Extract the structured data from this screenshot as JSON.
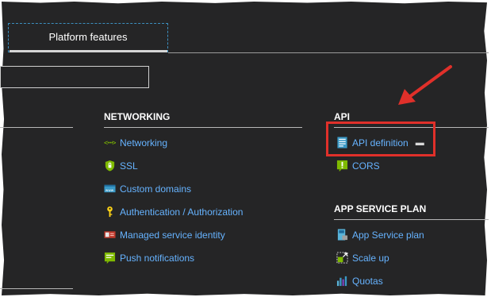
{
  "tabs": [
    {
      "label": "Platform features"
    }
  ],
  "search": {
    "value": ""
  },
  "networking": {
    "title": "NETWORKING",
    "items": [
      {
        "label": "Networking",
        "icon": "networking-icon"
      },
      {
        "label": "SSL",
        "icon": "ssl-shield-icon"
      },
      {
        "label": "Custom domains",
        "icon": "custom-domains-icon"
      },
      {
        "label": "Authentication / Authorization",
        "icon": "key-icon"
      },
      {
        "label": "Managed service identity",
        "icon": "identity-icon"
      },
      {
        "label": "Push notifications",
        "icon": "push-notifications-icon"
      }
    ]
  },
  "api": {
    "title": "API",
    "items": [
      {
        "label": "API definition",
        "icon": "api-definition-icon"
      },
      {
        "label": "CORS",
        "icon": "cors-icon"
      }
    ]
  },
  "app_service_plan": {
    "title": "APP SERVICE PLAN",
    "items": [
      {
        "label": "App Service plan",
        "icon": "app-service-plan-icon"
      },
      {
        "label": "Scale up",
        "icon": "scale-up-icon"
      },
      {
        "label": "Quotas",
        "icon": "quotas-icon"
      }
    ]
  },
  "colors": {
    "link": "#66b3ff",
    "highlight": "#e0302a",
    "background": "#252526"
  }
}
